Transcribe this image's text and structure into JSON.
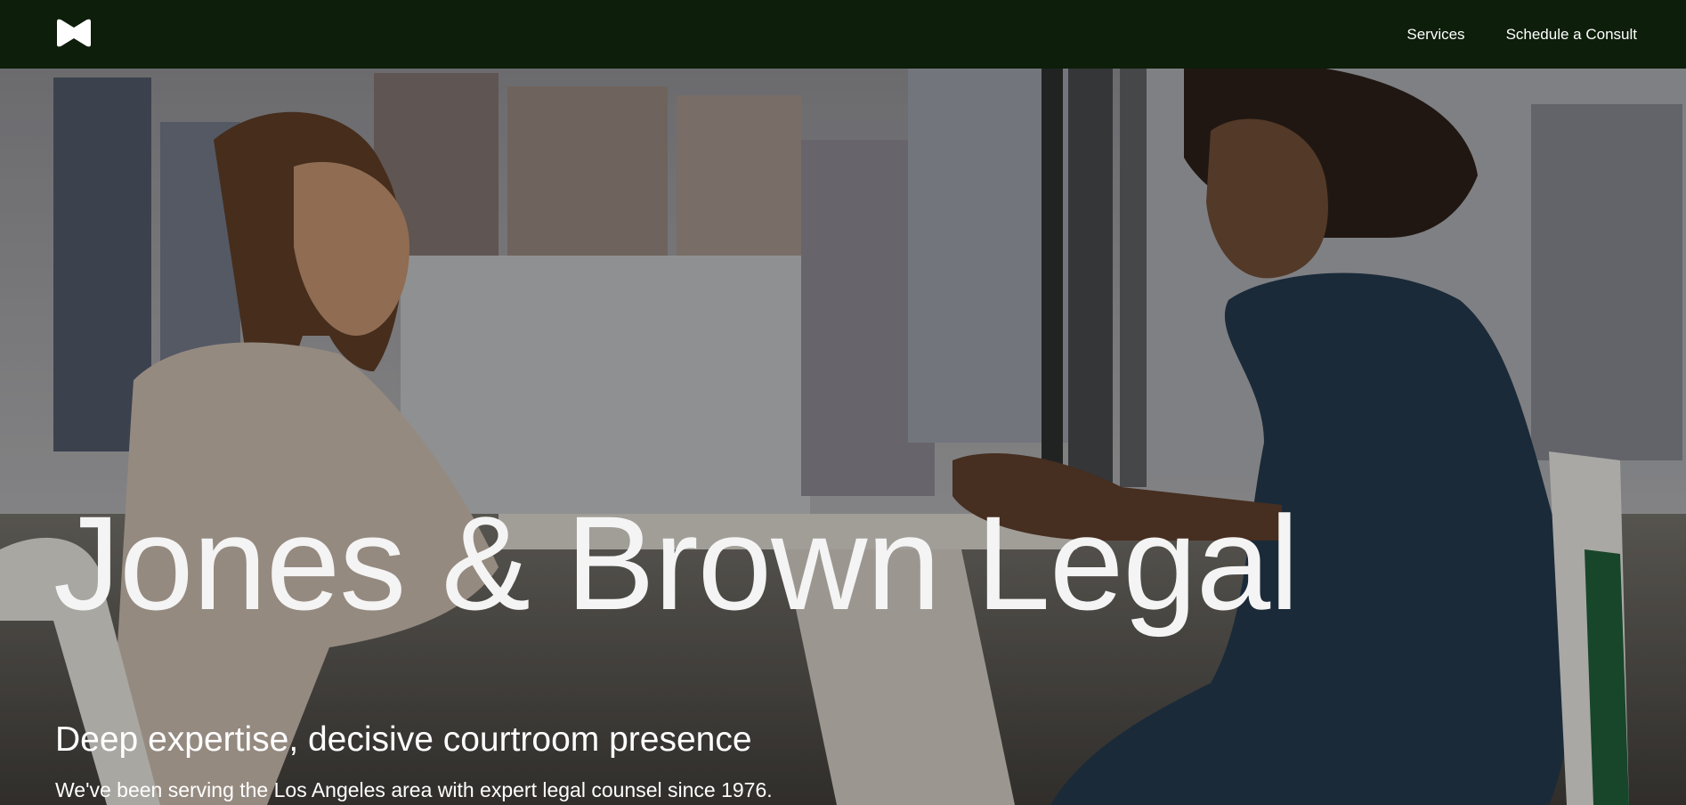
{
  "header": {
    "logo_icon": "bowtie-logo-icon",
    "nav": [
      {
        "label": "Services"
      },
      {
        "label": "Schedule a Consult"
      }
    ]
  },
  "hero": {
    "title": "Jones & Brown Legal",
    "subtitle": "Deep expertise, decisive courtroom presence",
    "tagline": "We've been serving the Los Angeles area with expert legal counsel since 1976.",
    "background_image": "two-women-meeting-at-office-window-photo"
  },
  "colors": {
    "header_bg": "#0d1e0a",
    "text": "#ffffff"
  }
}
